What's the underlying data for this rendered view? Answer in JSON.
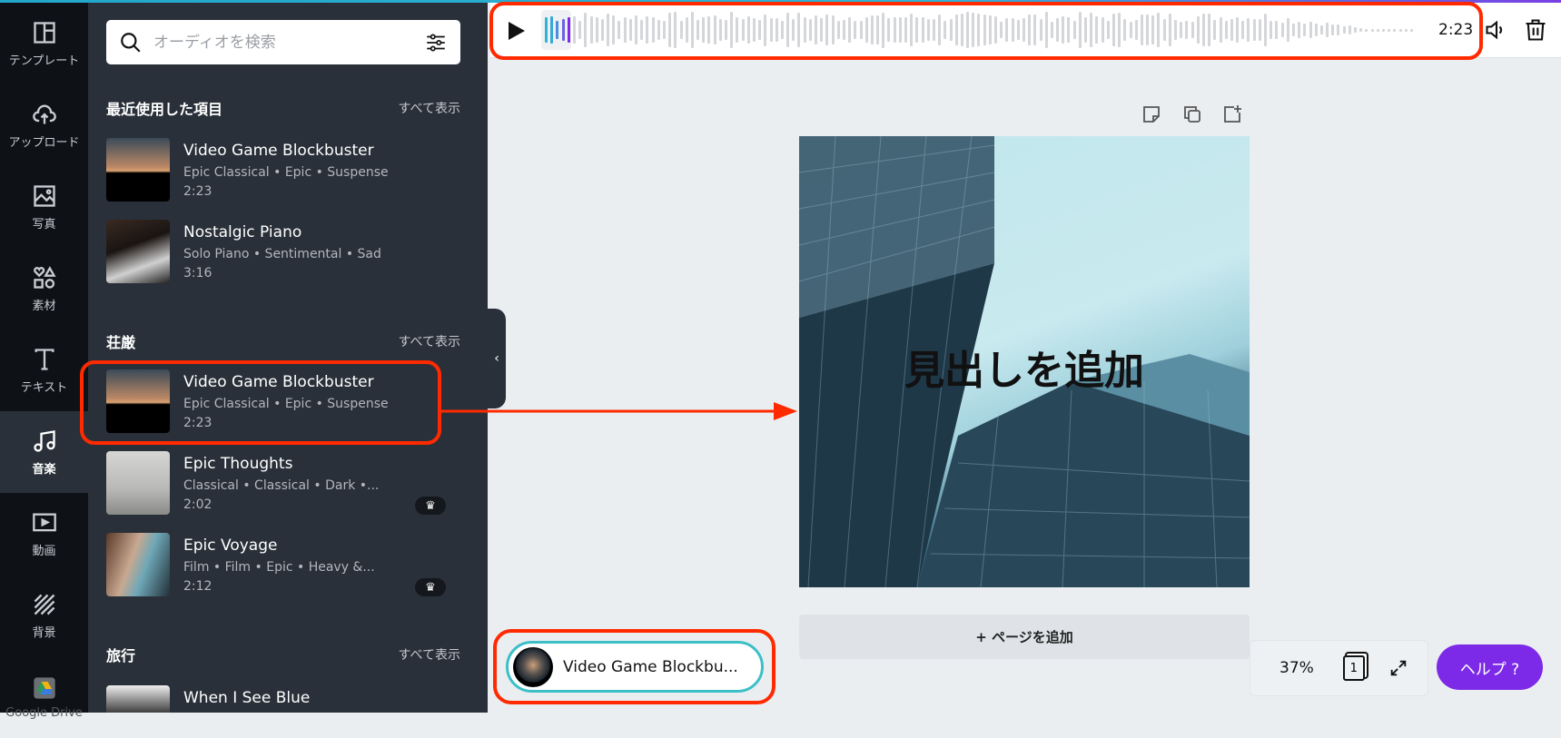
{
  "rail": {
    "items": [
      {
        "label": "テンプレート",
        "icon": "template-icon"
      },
      {
        "label": "アップロード",
        "icon": "upload-icon"
      },
      {
        "label": "写真",
        "icon": "photo-icon"
      },
      {
        "label": "素材",
        "icon": "elements-icon"
      },
      {
        "label": "テキスト",
        "icon": "text-icon"
      },
      {
        "label": "音楽",
        "icon": "music-icon",
        "active": true
      },
      {
        "label": "動画",
        "icon": "video-icon"
      },
      {
        "label": "背景",
        "icon": "background-icon"
      },
      {
        "label": "Google Drive",
        "icon": "google-drive-icon"
      }
    ]
  },
  "search": {
    "placeholder": "オーディオを検索"
  },
  "sections": [
    {
      "title": "最近使用した項目",
      "see_all": "すべて表示",
      "tracks": [
        {
          "title": "Video Game Blockbuster",
          "tags": "Epic Classical • Epic • Suspense",
          "duration": "2:23"
        },
        {
          "title": "Nostalgic Piano",
          "tags": "Solo Piano • Sentimental • Sad",
          "duration": "3:16"
        }
      ]
    },
    {
      "title": "荘厳",
      "see_all": "すべて表示",
      "tracks": [
        {
          "title": "Video Game Blockbuster",
          "tags": "Epic Classical • Epic • Suspense",
          "duration": "2:23"
        },
        {
          "title": "Epic Thoughts",
          "tags": "Classical • Classical • Dark •...",
          "duration": "2:02",
          "pro": true
        },
        {
          "title": "Epic Voyage",
          "tags": "Film • Film • Epic • Heavy &...",
          "duration": "2:12",
          "pro": true
        }
      ]
    },
    {
      "title": "旅行",
      "see_all": "すべて表示",
      "tracks": [
        {
          "title": "When I See Blue"
        }
      ]
    }
  ],
  "player": {
    "duration": "2:23"
  },
  "canvas": {
    "heading": "見出しを追加",
    "add_page": "+ ページを追加"
  },
  "audio_pill": {
    "title": "Video Game Blockbu..."
  },
  "footer": {
    "zoom": "37%",
    "page_number": "1",
    "help": "ヘルプ ?"
  },
  "colors": {
    "accent": "#7d2ae8",
    "highlight": "#ff2a00",
    "pill_border": "#3cbfc7",
    "panel": "#293039",
    "rail": "#0e1217"
  }
}
